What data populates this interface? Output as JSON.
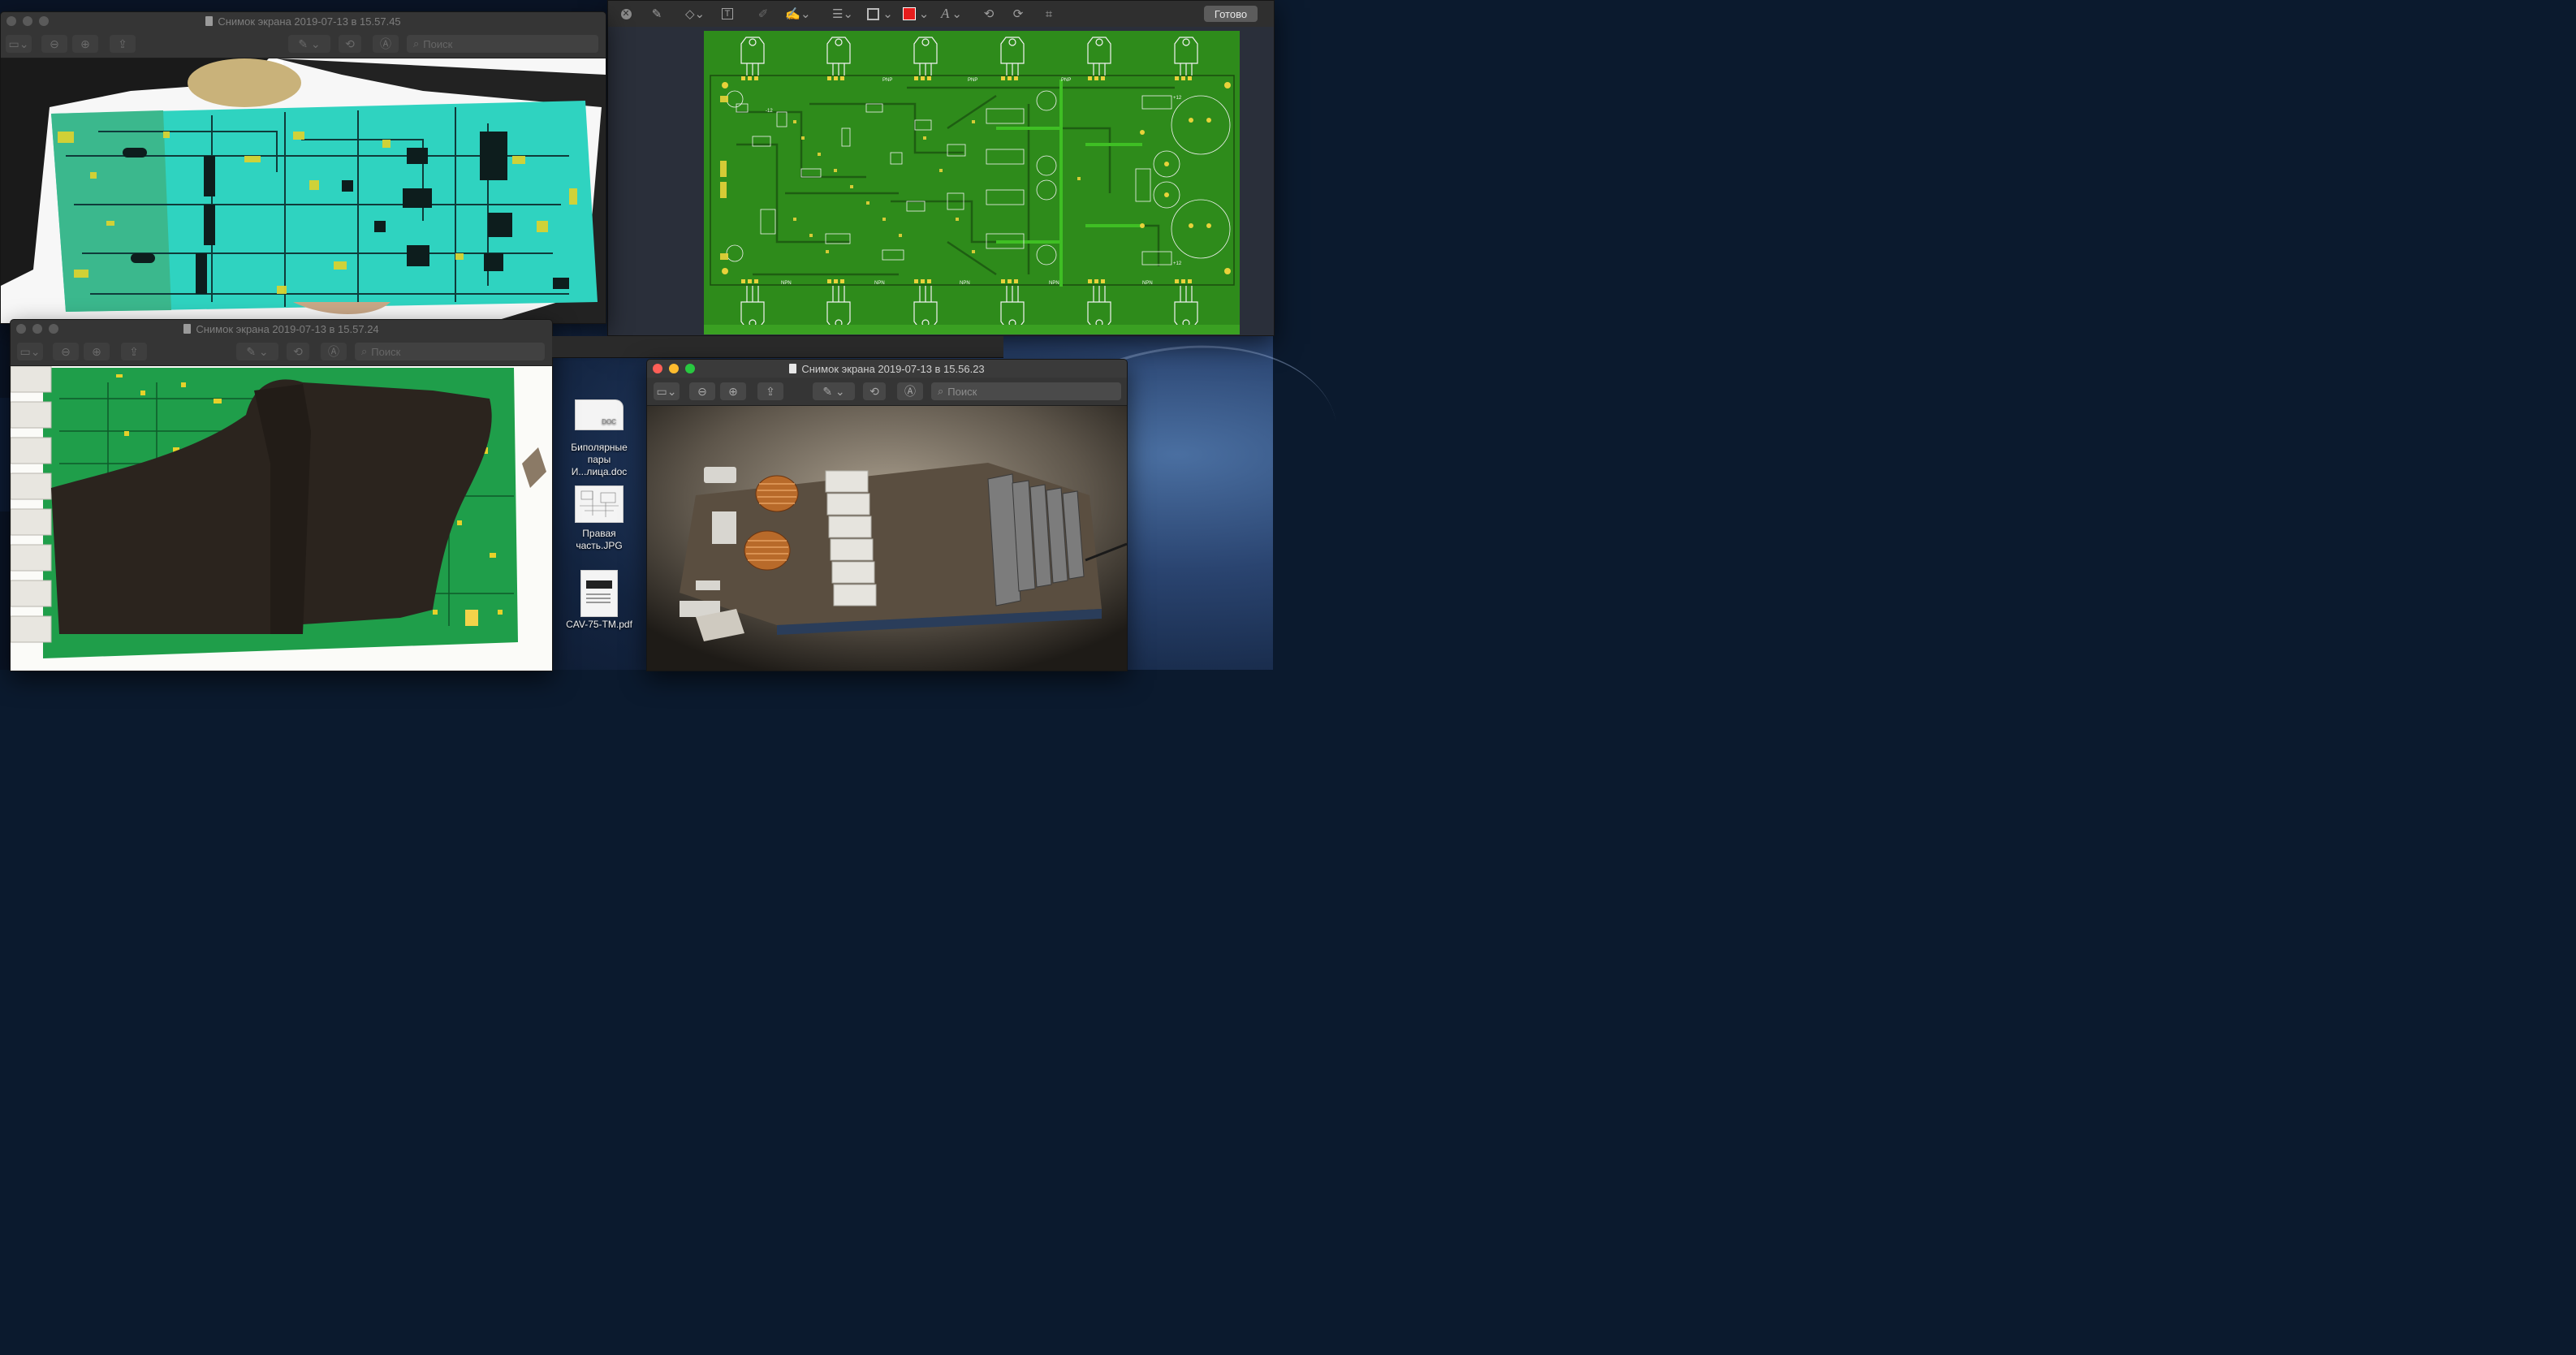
{
  "windows": {
    "top_left": {
      "title": "Снимок экрана 2019-07-13 в 15.57.45",
      "search_placeholder": "Поиск"
    },
    "bottom_left": {
      "title": "Снимок экрана 2019-07-13 в 15.57.24",
      "search_placeholder": "Поиск"
    },
    "bottom_right": {
      "title": "Снимок экрана 2019-07-13 в 15.56.23",
      "search_placeholder": "Поиск"
    },
    "markup": {
      "done_label": "Готово"
    }
  },
  "desktop_icons": [
    {
      "label": "Биполярные пары И...лица.doc",
      "badge": "DOC"
    },
    {
      "label": "Правая часть.JPG"
    },
    {
      "label": "CAV-75-TM.pdf"
    }
  ],
  "pcb_labels": {
    "pnp": "PNP",
    "npn": "NPN",
    "plus12": "+12",
    "minus12": "-12"
  },
  "colors": {
    "pcb_green": "#2e8b1b",
    "pcb_dark": "#1e5e12",
    "pad_yellow": "#e8d23a",
    "photo_cyan": "#2fd3c0"
  }
}
